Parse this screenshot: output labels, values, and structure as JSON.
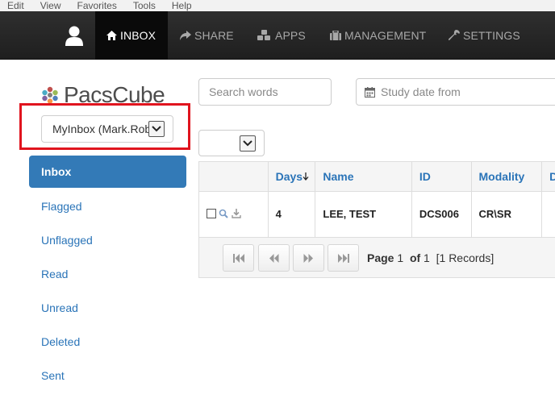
{
  "menubar": [
    "Edit",
    "View",
    "Favorites",
    "Tools",
    "Help"
  ],
  "nav": {
    "items": [
      {
        "label": "INBOX",
        "icon": "home-icon"
      },
      {
        "label": "SHARE",
        "icon": "share-icon"
      },
      {
        "label": "APPS",
        "icon": "apps-icon"
      },
      {
        "label": "MANAGEMENT",
        "icon": "briefcase-icon"
      },
      {
        "label": "SETTINGS",
        "icon": "wrench-icon"
      }
    ]
  },
  "logo": {
    "text": "PacsCube"
  },
  "inbox_select": {
    "value": "MyInbox (Mark.Rob"
  },
  "sidebar": {
    "items": [
      "Inbox",
      "Flagged",
      "Unflagged",
      "Read",
      "Unread",
      "Deleted",
      "Sent"
    ]
  },
  "search": {
    "placeholder": "Search words"
  },
  "date_from": {
    "placeholder": "Study date from"
  },
  "table": {
    "columns": [
      "Days",
      "Name",
      "ID",
      "Modality",
      "D"
    ],
    "rows": [
      {
        "days": "4",
        "name": "LEE, TEST",
        "id": "DCS006",
        "modality": "CR\\SR"
      }
    ]
  },
  "pager": {
    "page_label": "Page",
    "page": "1",
    "of_label": "of",
    "total": "1",
    "records": "[1 Records]"
  },
  "colors": {
    "accent": "#337ab7",
    "link": "#2a74b8",
    "highlight": "#e0141e",
    "nav_bg": "#2a2a2a"
  }
}
